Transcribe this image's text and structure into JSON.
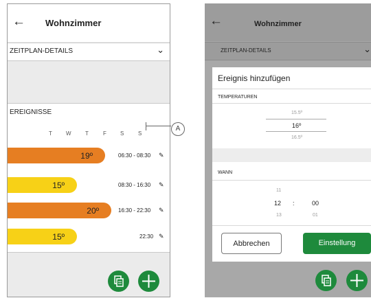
{
  "left": {
    "header": {
      "back_icon": "←",
      "title": "Wohnzimmer"
    },
    "schedule_details": {
      "label": "ZEITPLAN-DETAILS",
      "chevron": "⌄"
    },
    "events_label": "EREIGNISSE",
    "days": [
      "T",
      "W",
      "T",
      "F",
      "S",
      "S"
    ],
    "events": [
      {
        "temp": "19º",
        "time": "06:30 - 08:30",
        "color": "#e67e22",
        "level": 0.6
      },
      {
        "temp": "15º",
        "time": "08:30 - 16:30",
        "color": "#f7d117",
        "level": 0.43
      },
      {
        "temp": "20º",
        "time": "16:30 - 22:30",
        "color": "#e67e22",
        "level": 0.64
      },
      {
        "temp": "15º",
        "time": "22:30",
        "color": "#f7d117",
        "level": 0.43
      }
    ],
    "fab_copy_icon": "copy-icon",
    "fab_add_icon": "plus-icon"
  },
  "callout": {
    "label": "A"
  },
  "right": {
    "header": {
      "back_icon": "←",
      "title": "Wohnzimmer"
    },
    "schedule_details": {
      "label": "ZEITPLAN-DETAILS",
      "chevron": "⌄"
    },
    "dialog": {
      "title": "Ereignis hinzufügen",
      "temperatures_label": "TEMPERATUREN",
      "temp_above": "15.5º",
      "temp_selected": "16º",
      "temp_below": "16.5º",
      "when_label": "WANN",
      "hour_above": "11",
      "hour_selected": "12",
      "separator": ":",
      "minute_selected": "00",
      "hour_below": "13",
      "minute_below": "01",
      "cancel_label": "Abbrechen",
      "confirm_label": "Einstellung"
    },
    "accent": "#1e8a3c"
  }
}
